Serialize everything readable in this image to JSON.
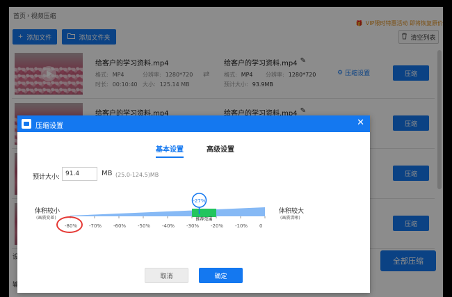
{
  "breadcrumb": {
    "home": "首页",
    "sep": "›",
    "current": "视频压缩"
  },
  "vip_text": "VIP限时特惠活动   即将恢复原价",
  "toolbar": {
    "add_file": "添加文件",
    "add_folder": "添加文件夹",
    "clear_list": "清空列表"
  },
  "files": [
    {
      "name": "给客户的学习资料.mp4",
      "format_label": "格式:",
      "format": "MP4",
      "resolution_label": "分辨率:",
      "resolution": "1280*720",
      "duration_label": "时长:",
      "duration": "00:10:40",
      "size_label": "大小:",
      "size": "125.14 MB",
      "output_name": "给客户的学习资料.mp4",
      "out_format_label": "格式:",
      "out_format": "MP4",
      "out_resolution_label": "分辨率:",
      "out_resolution": "1280*720",
      "est_label": "预计大小:",
      "est_size": "93.9MB",
      "settings": "压缩设置",
      "compress": "压缩"
    },
    {
      "name": "给客户的学习资料.mp4",
      "output_name": "给客户的学习资料.mp4",
      "compress": "压缩"
    },
    {
      "compress": "压缩"
    },
    {
      "compress": "压缩"
    }
  ],
  "compress_all": "全部压缩",
  "bottom": {
    "line1": "设",
    "line2": "输"
  },
  "dialog": {
    "title": "压缩设置",
    "close": "✕",
    "tab_basic": "基本设置",
    "tab_advanced": "高级设置",
    "size_label": "预计大小:",
    "size_value": "91.4",
    "size_unit": "MB",
    "size_range": "(25.0-124.5)MB",
    "left_label": "体积较小",
    "left_sub": "(画质变差)",
    "right_label": "体积较大",
    "right_sub": "(画质清晰)",
    "recommended": "推荐范围",
    "marker": "-27%",
    "ticks": [
      "-80%",
      "-70%",
      "-60%",
      "-50%",
      "-40%",
      "-30%",
      "-20%",
      "-10%",
      "0"
    ],
    "cancel": "取消",
    "ok": "确定"
  },
  "slider": {
    "value_percent": -27,
    "min_percent": -80,
    "max_percent": 0,
    "recommended_range": [
      -30,
      -20
    ]
  },
  "colors": {
    "accent": "#1478f0",
    "recommended": "#22c55e",
    "annotation": "#e53935"
  }
}
